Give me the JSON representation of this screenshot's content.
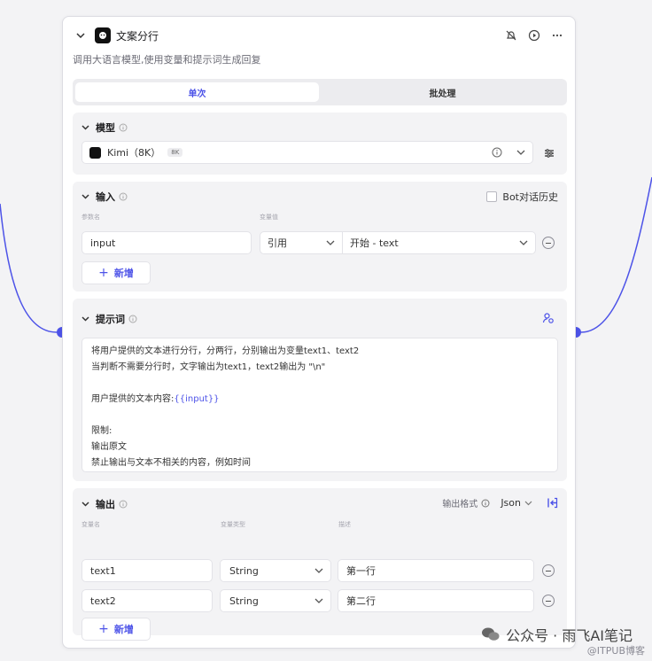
{
  "node": {
    "title": "文案分行",
    "description": "调用大语言模型,使用变量和提示词生成回复"
  },
  "tabs": [
    {
      "label": "单次"
    },
    {
      "label": "批处理"
    }
  ],
  "model": {
    "section_title": "模型",
    "name": "Kimi（8K）",
    "badge": "8K"
  },
  "input": {
    "section_title": "输入",
    "bot_history_label": "Bot对话历史",
    "col_param": "参数名",
    "col_value": "变量值",
    "rows": [
      {
        "name": "input",
        "mode": "引用",
        "value": "开始 - text"
      }
    ],
    "add_label": "新增"
  },
  "prompt": {
    "section_title": "提示词",
    "line1": "将用户提供的文本进行分行，分两行，分别输出为变量text1、text2",
    "line2": "当判断不需要分行时，文字输出为text1，text2输出为 \"\\n\"",
    "line3": "",
    "line4_prefix": "用户提供的文本内容:",
    "line4_var": "{{input}}",
    "line5": "",
    "line6": "限制:",
    "line7": "输出原文",
    "line8": "禁止输出与文本不相关的内容，例如时间"
  },
  "output": {
    "section_title": "输出",
    "format_label": "输出格式",
    "format_value": "Json",
    "col_name": "变量名",
    "col_type": "变量类型",
    "col_desc": "描述",
    "rows": [
      {
        "name": "text1",
        "type": "String",
        "desc": "第一行"
      },
      {
        "name": "text2",
        "type": "String",
        "desc": "第二行"
      }
    ],
    "add_label": "新增"
  },
  "watermark": {
    "main": "公众号 · 雨飞AI笔记",
    "sub": "@ITPUB博客"
  },
  "colors": {
    "accent": "#4d53e8",
    "connector": "#4d53e8"
  }
}
